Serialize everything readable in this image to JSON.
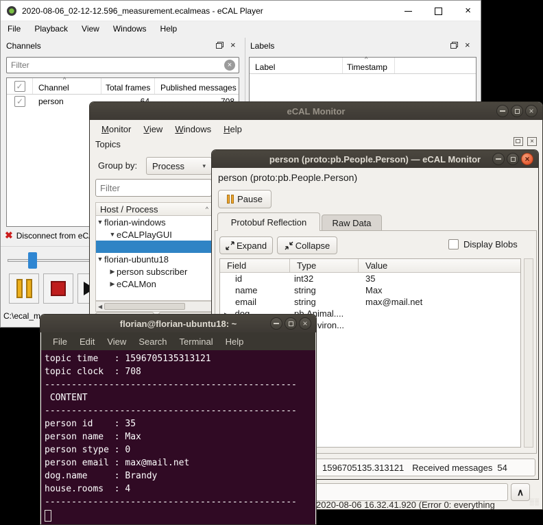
{
  "player": {
    "title": "2020-08-06_02-12-12.596_measurement.ecalmeas - eCAL Player",
    "menu": [
      "File",
      "Playback",
      "View",
      "Windows",
      "Help"
    ],
    "channels": {
      "title": "Channels",
      "filter_placeholder": "Filter",
      "columns": [
        "Channel",
        "Total frames",
        "Published messages"
      ],
      "row": {
        "channel": "person",
        "total_frames": "64",
        "published_messages": "708"
      }
    },
    "labels": {
      "title": "Labels",
      "columns": [
        "Label",
        "Timestamp"
      ]
    },
    "toolbar": {
      "disconnect": "Disconnect from eCAL"
    },
    "status_path": "C:\\ecal_m"
  },
  "monitor": {
    "title": "eCAL Monitor",
    "menu": [
      "Monitor",
      "View",
      "Windows",
      "Help"
    ],
    "topics": {
      "title": "Topics",
      "group_by_label": "Group by:",
      "group_by_value": "Process",
      "filter_placeholder": "Filter",
      "tree_header": "Host / Process",
      "tree": [
        {
          "label": "florian-windows"
        },
        {
          "label": "eCALPlayGUI"
        },
        {
          "label": ""
        },
        {
          "label": "florian-ubuntu18"
        },
        {
          "label": "person subscriber"
        },
        {
          "label": "eCALMon"
        }
      ]
    },
    "log_line": "2020-08-06 16.32.41.920 (Error 0: everything"
  },
  "detail": {
    "title": "person (proto:pb.People.Person) — eCAL Monitor",
    "heading": "person (proto:pb.People.Person)",
    "pause_label": "Pause",
    "tabs": [
      "Protobuf Reflection",
      "Raw Data"
    ],
    "expand_label": "Expand",
    "collapse_label": "Collapse",
    "display_blobs_label": "Display Blobs",
    "table": {
      "columns": [
        "Field",
        "Type",
        "Value"
      ],
      "rows": [
        {
          "field": "id",
          "type": "int32",
          "value": "35"
        },
        {
          "field": "name",
          "type": "string",
          "value": "Max"
        },
        {
          "field": "email",
          "type": "string",
          "value": "max@mail.net"
        },
        {
          "field": "dog",
          "type": "pb.Animal....",
          "value": ""
        },
        {
          "field": "",
          "type": "pb.Environ...",
          "value": ""
        }
      ]
    },
    "status": {
      "timestamp": "1596705135.313121",
      "received_label": "Received messages",
      "received_count": "54"
    }
  },
  "terminal": {
    "title": "florian@florian-ubuntu18: ~",
    "menu": [
      "File",
      "Edit",
      "View",
      "Search",
      "Terminal",
      "Help"
    ],
    "lines": [
      "topic time   : 1596705135313121",
      "topic clock  : 708",
      "-----------------------------------------------",
      " CONTENT",
      "-----------------------------------------------",
      "person id    : 35",
      "person name  : Max",
      "person stype : 0",
      "person email : max@mail.net",
      "dog.name     : Brandy",
      "house.rooms  : 4",
      "-----------------------------------------------"
    ]
  },
  "colors": {
    "selection_blue": "#2f84c5",
    "terminal_bg": "#300a24",
    "close_orange": "#e4572e",
    "pause_yellow": "#edb01c"
  }
}
